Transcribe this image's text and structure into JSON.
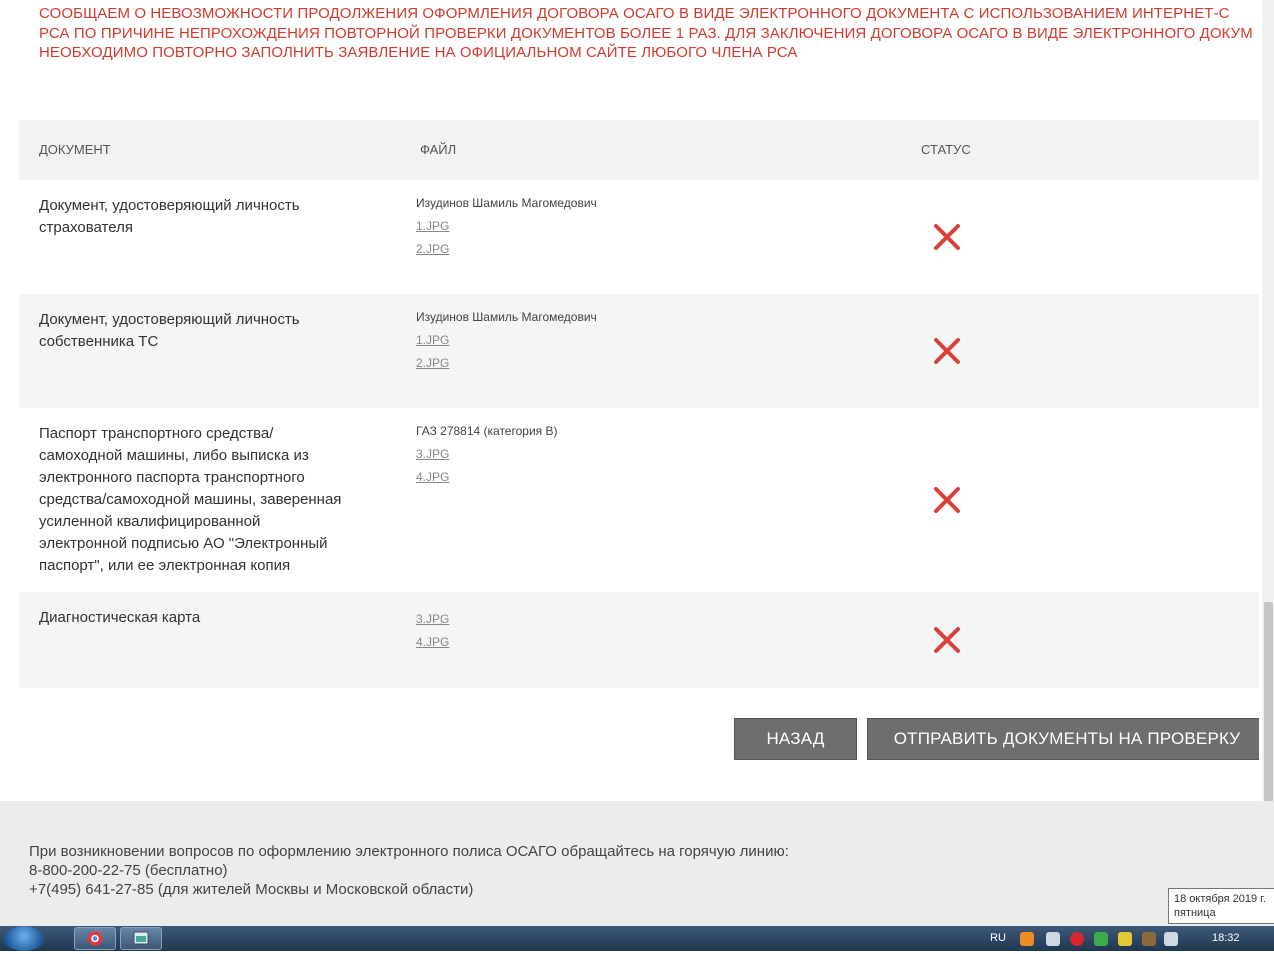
{
  "notice": {
    "line1": "СООБЩАЕМ О НЕВОЗМОЖНОСТИ ПРОДОЛЖЕНИЯ ОФОРМЛЕНИЯ ДОГОВОРА ОСАГО В ВИДЕ ЭЛЕКТРОННОГО ДОКУМЕНТА С ИСПОЛЬЗОВАНИЕМ ИНТЕРНЕТ-С",
    "line2": "РСА ПО ПРИЧИНЕ НЕПРОХОЖДЕНИЯ ПОВТОРНОЙ ПРОВЕРКИ ДОКУМЕНТОВ БОЛЕЕ 1 РАЗ. ДЛЯ ЗАКЛЮЧЕНИЯ ДОГОВОРА ОСАГО В ВИДЕ ЭЛЕКТРОННОГО ДОКУМ",
    "line3": "НЕОБХОДИМО ПОВТОРНО ЗАПОЛНИТЬ ЗАЯВЛЕНИЕ НА ОФИЦИАЛЬНОМ САЙТЕ ЛЮБОГО ЧЛЕНА РСА"
  },
  "table": {
    "headers": {
      "document": "ДОКУМЕНТ",
      "file": "ФАЙЛ",
      "status": "СТАТУС"
    },
    "rows": [
      {
        "doc_lines": [
          "Документ, удостоверяющий личность",
          "страхователя"
        ],
        "owner": "Изудинов Шамиль Магомедович",
        "files": [
          "1.JPG",
          "2.JPG"
        ]
      },
      {
        "doc_lines": [
          "Документ, удостоверяющий личность",
          "собственника ТС"
        ],
        "owner": "Изудинов Шамиль Магомедович",
        "files": [
          "1.JPG",
          "2.JPG"
        ]
      },
      {
        "doc_lines": [
          "Паспорт транспортного средства/",
          "самоходной машины, либо выписка из",
          "электронного паспорта транспортного",
          "средства/самоходной машины, заверенная",
          "усиленной квалифицированной",
          "электронной подписью АО \"Электронный",
          "паспорт\", или ее электронная копия"
        ],
        "owner": "ГАЗ 278814 (категория B)",
        "files": [
          "3.JPG",
          "4.JPG"
        ]
      },
      {
        "doc_lines": [
          "Диагностическая карта"
        ],
        "owner": "",
        "files": [
          "3.JPG",
          "4.JPG"
        ]
      }
    ],
    "status_color": "#d9403a"
  },
  "buttons": {
    "back": "НАЗАД",
    "submit": "ОТПРАВИТЬ ДОКУМЕНТЫ НА ПРОВЕРКУ"
  },
  "footer": {
    "line1": "При возникновении вопросов по оформлению электронного полиса ОСАГО обращайтесь на горячую линию:",
    "line2": "8-800-200-22-75 (бесплатно)",
    "line3": "+7(495) 641-27-85 (для жителей Москвы и Московской области)"
  },
  "tooltip": {
    "date": "18 октября 2019 г.",
    "weekday": "пятница"
  },
  "taskbar": {
    "language": "RU",
    "time": "18:32"
  }
}
